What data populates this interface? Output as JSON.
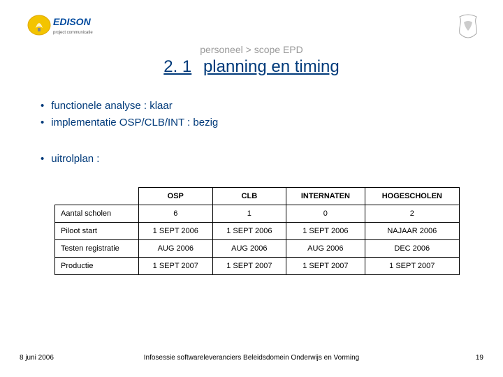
{
  "logo_text": "EDISON",
  "logo_sub": "project communicatie",
  "breadcrumb": "personeel > scope EPD",
  "title_num": "2. 1",
  "title_text": "planning en timing",
  "bullets_a": [
    "functionele analyse : klaar",
    "implementatie OSP/CLB/INT : bezig"
  ],
  "bullets_b": [
    "uitrolplan :"
  ],
  "chart_data": {
    "type": "table",
    "columns": [
      "OSP",
      "CLB",
      "INTERNATEN",
      "HOGESCHOLEN"
    ],
    "rows": [
      {
        "label": "Aantal scholen",
        "values": [
          "6",
          "1",
          "0",
          "2"
        ]
      },
      {
        "label": "Piloot start",
        "values": [
          "1 SEPT 2006",
          "1 SEPT 2006",
          "1 SEPT 2006",
          "NAJAAR 2006"
        ]
      },
      {
        "label": "Testen registratie",
        "values": [
          "AUG 2006",
          "AUG 2006",
          "AUG 2006",
          "DEC 2006"
        ]
      },
      {
        "label": "Productie",
        "values": [
          "1 SEPT 2007",
          "1 SEPT 2007",
          "1 SEPT 2007",
          "1 SEPT 2007"
        ]
      }
    ]
  },
  "footer_date": "8 juni 2006",
  "footer_text": "Infosessie softwareleveranciers Beleidsdomein Onderwijs en Vorming",
  "footer_page": "19"
}
